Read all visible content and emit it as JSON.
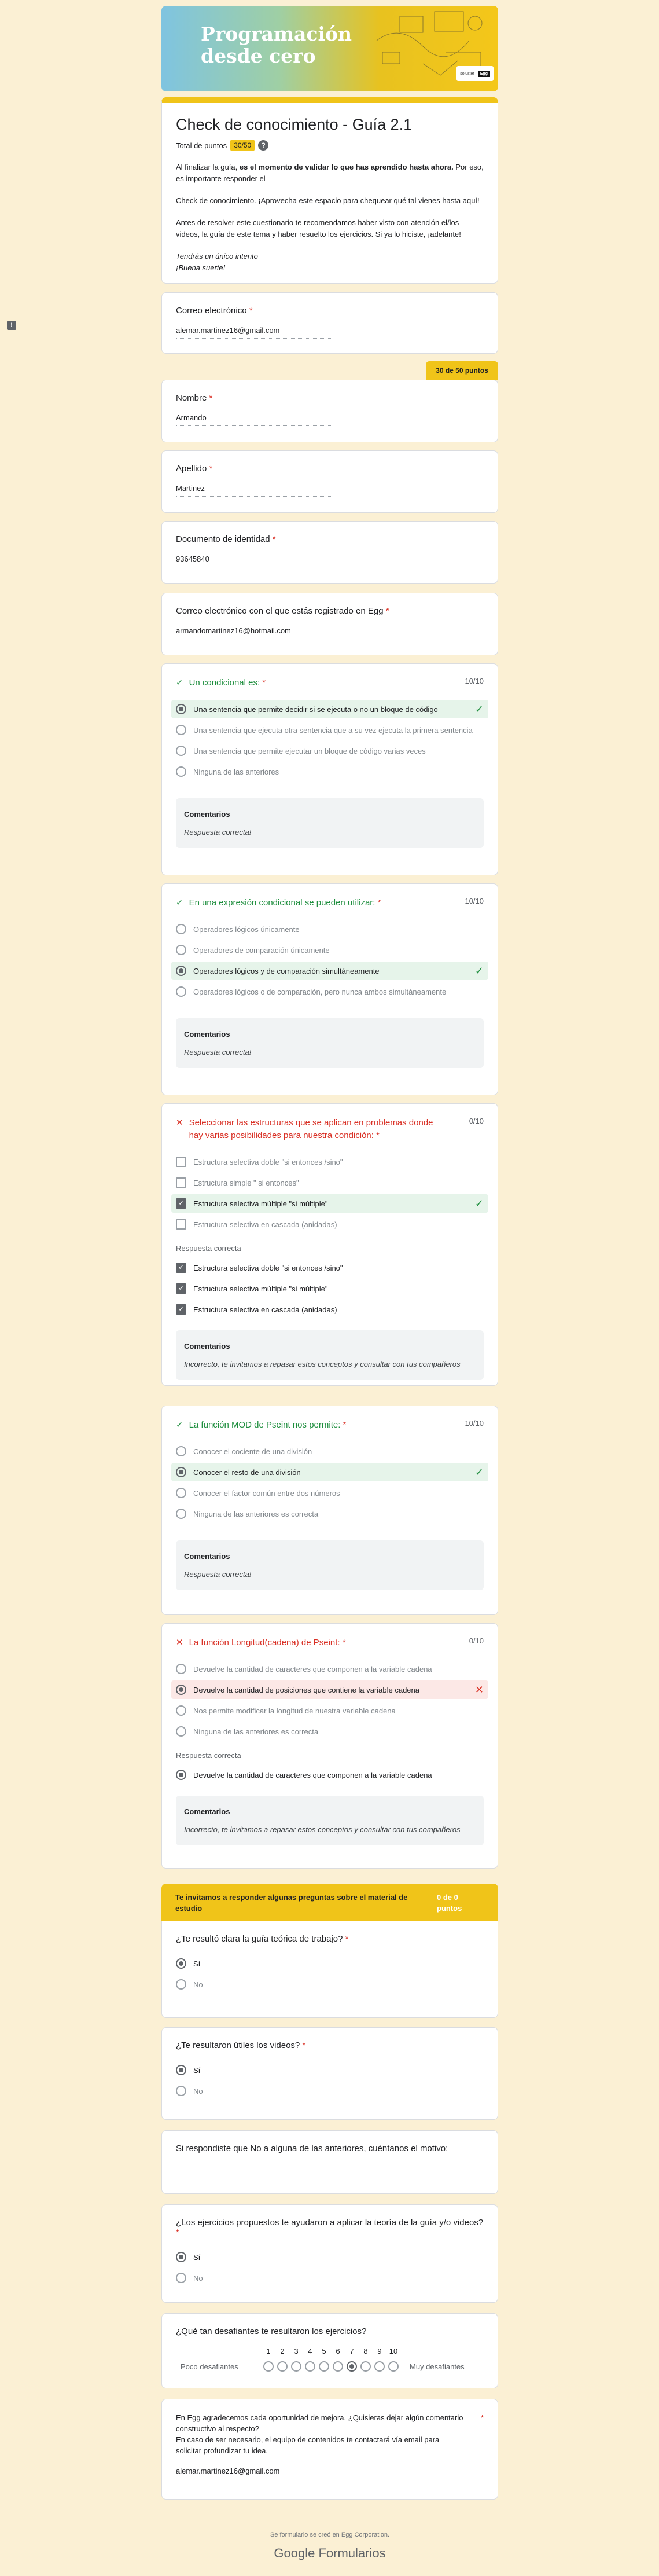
{
  "banner": {
    "title_line1": "Programación",
    "title_line2": "desde cero",
    "logo1": "soluster",
    "logo2": "Egg"
  },
  "header": {
    "title": "Check de conocimiento - Guía 2.1",
    "total_label": "Total de puntos",
    "total_value": "30/50",
    "desc1_a": "Al finalizar la guía, ",
    "desc1_b": "es el momento de validar lo que has aprendido hasta ahora.",
    "desc1_c": " Por eso, es importante responder el",
    "desc2": "Check de conocimiento. ¡Aprovecha este espacio para chequear qué tal vienes hasta aquí!",
    "desc3": "Antes de resolver este cuestionario te recomendamos haber visto con atención el/los videos, la guía de este tema y haber resuelto los ejercicios. Si ya lo hiciste, ¡adelante!",
    "desc4a": "Tendrás un único intento",
    "desc4b": "¡Buena suerte!"
  },
  "email": {
    "label": "Correo electrónico",
    "value": "alemar.martinez16@gmail.com"
  },
  "score_tag": "30 de 50 puntos",
  "nombre": {
    "label": "Nombre",
    "value": "Armando"
  },
  "apellido": {
    "label": "Apellido",
    "value": "Martinez"
  },
  "documento": {
    "label": "Documento de identidad",
    "value": "93645840"
  },
  "egg_email": {
    "label": "Correo electrónico con el que estás registrado en Egg",
    "value": "armandomartinez16@hotmail.com"
  },
  "q1": {
    "title": "Un condicional es:",
    "pts": "10/10",
    "options": [
      "Una sentencia que permite decidir si se ejecuta o no un bloque de código",
      "Una sentencia que ejecuta otra sentencia que a su vez ejecuta la primera sentencia",
      "Una sentencia que permite ejecutar un bloque de código varias veces",
      "Ninguna de las anteriores"
    ],
    "fb_head": "Comentarios",
    "fb": "Respuesta correcta!"
  },
  "q2": {
    "title": "En una expresión condicional se pueden utilizar:",
    "pts": "10/10",
    "options": [
      "Operadores lógicos únicamente",
      "Operadores de comparación únicamente",
      "Operadores lógicos y de comparación simultáneamente",
      "Operadores lógicos o de comparación, pero nunca ambos simultáneamente"
    ],
    "fb_head": "Comentarios",
    "fb": "Respuesta correcta!"
  },
  "q3": {
    "title": "Seleccionar las estructuras que se aplican en problemas donde hay varias posibilidades para nuestra condición:",
    "pts": "0/10",
    "options": [
      "Estructura selectiva doble \"si entonces /sino\"",
      "Estructura simple \" si entonces\"",
      "Estructura selectiva múltiple \"si múltiple\"",
      "Estructura selectiva en cascada (anidadas)"
    ],
    "correct_label": "Respuesta correcta",
    "correct": [
      "Estructura selectiva doble \"si entonces /sino\"",
      "Estructura selectiva múltiple \"si múltiple\"",
      "Estructura selectiva en cascada (anidadas)"
    ],
    "fb_head": "Comentarios",
    "fb": "Incorrecto, te invitamos a repasar estos conceptos y consultar con tus compañeros"
  },
  "q4": {
    "title": "La función MOD de Pseint nos permite:",
    "pts": "10/10",
    "options": [
      "Conocer el cociente de una división",
      "Conocer el resto de una división",
      "Conocer el factor común entre dos números",
      "Ninguna de las anteriores es correcta"
    ],
    "fb_head": "Comentarios",
    "fb": "Respuesta correcta!"
  },
  "q5": {
    "title": "La función Longitud(cadena) de Pseint:",
    "pts": "0/10",
    "options": [
      "Devuelve la cantidad de caracteres que componen a la variable cadena",
      "Devuelve la cantidad de posiciones que contiene la variable cadena",
      "Nos permite modificar la longitud de nuestra variable cadena",
      "Ninguna de las anteriores es correcta"
    ],
    "correct_label": "Respuesta correcta",
    "correct": [
      "Devuelve la cantidad de caracteres que componen a la variable cadena"
    ],
    "fb_head": "Comentarios",
    "fb": "Incorrecto, te invitamos a repasar estos conceptos y consultar con tus compañeros"
  },
  "section": {
    "title": "Te invitamos a responder algunas preguntas sobre el material de estudio",
    "pts": "0 de 0 puntos"
  },
  "s1": {
    "title": "¿Te resultó clara la guía teórica de trabajo?",
    "yes": "Sí",
    "no": "No"
  },
  "s2": {
    "title": "¿Te resultaron útiles los videos?",
    "yes": "Sí",
    "no": "No"
  },
  "s3": {
    "title": "Si respondiste que No a alguna de las anteriores, cuéntanos el motivo:"
  },
  "s4": {
    "title": "¿Los ejercicios propuestos te ayudaron a aplicar la teoría de la guía y/o videos?",
    "yes": "Sí",
    "no": "No"
  },
  "s5": {
    "title": "¿Qué tan desafiantes te resultaron los ejercicios?",
    "low": "Poco desafiantes",
    "high": "Muy desafiantes",
    "nums": [
      "1",
      "2",
      "3",
      "4",
      "5",
      "6",
      "7",
      "8",
      "9",
      "10"
    ],
    "selected": 7
  },
  "s6": {
    "line1": "En Egg agradecemos cada oportunidad de mejora. ¿Quisieras dejar algún comentario constructivo al respecto?",
    "line2": "En caso de ser necesario, el equipo de contenidos te contactará vía email para solicitar profundizar tu idea.",
    "value": "alemar.martinez16@gmail.com"
  },
  "footer": {
    "text": "Se formulario se creó en Egg Corporation.",
    "brand1": "Google",
    "brand2": "Formularios"
  }
}
